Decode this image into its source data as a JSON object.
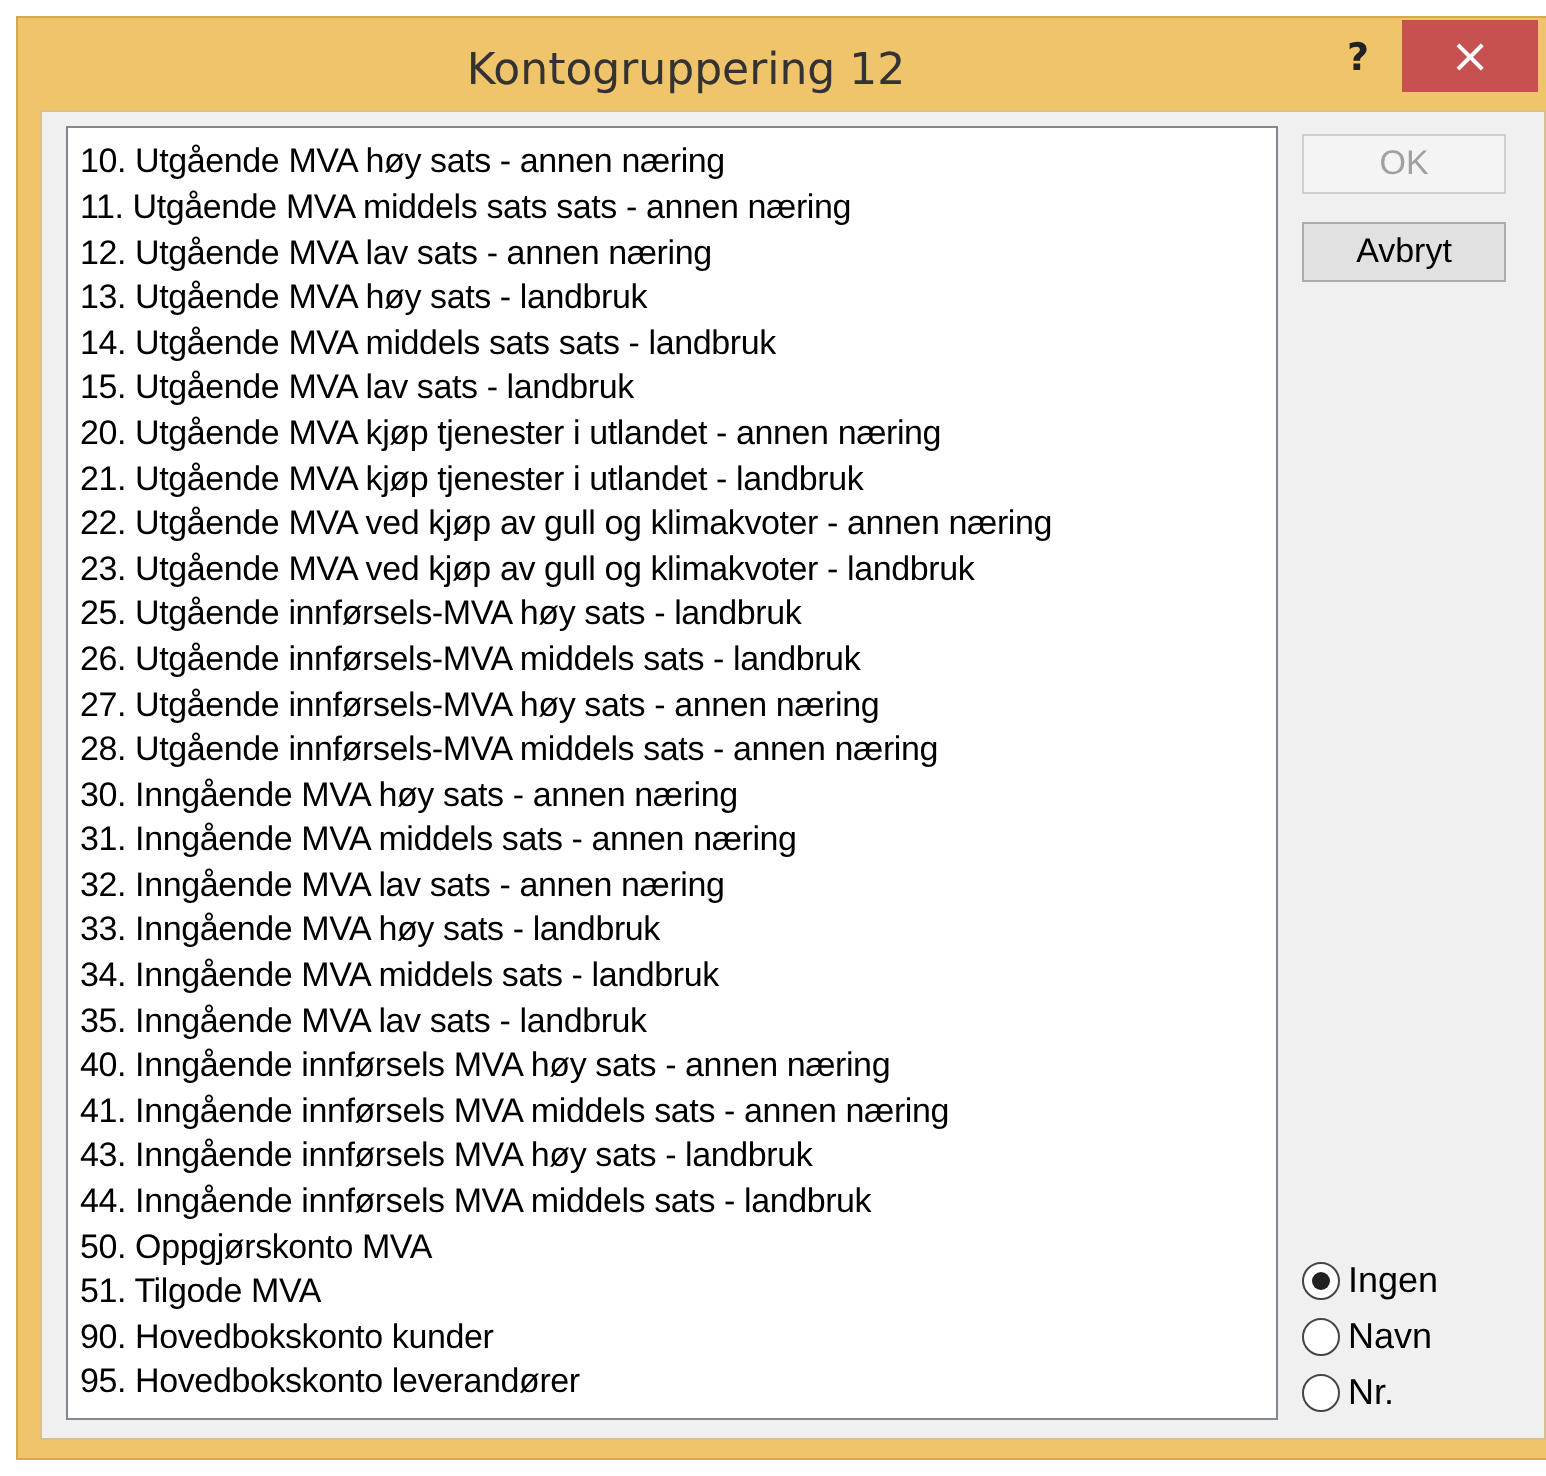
{
  "window": {
    "title": "Kontogruppering 12",
    "help": "?",
    "close": "×"
  },
  "accounts": [
    {
      "label": "10. Utgående MVA høy sats - annen næring",
      "selected": false
    },
    {
      "label": "11. Utgående MVA middels sats sats - annen næring",
      "selected": false
    },
    {
      "label": "12. Utgående MVA lav sats - annen næring",
      "selected": false
    },
    {
      "label": "13. Utgående MVA høy sats - landbruk",
      "selected": false
    },
    {
      "label": "14. Utgående MVA middels sats sats - landbruk",
      "selected": false
    },
    {
      "label": "15. Utgående MVA lav sats - landbruk",
      "selected": false
    },
    {
      "label": "20. Utgående MVA kjøp tjenester i utlandet - annen næring",
      "selected": false
    },
    {
      "label": "21. Utgående MVA kjøp tjenester i utlandet - landbruk",
      "selected": false
    },
    {
      "label": "22. Utgående MVA ved kjøp av gull og klimakvoter - annen næring",
      "selected": false
    },
    {
      "label": "23. Utgående MVA ved kjøp av gull og klimakvoter - landbruk",
      "selected": false
    },
    {
      "label": "25. Utgående innførsels-MVA høy sats - landbruk",
      "selected": false
    },
    {
      "label": "26. Utgående innførsels-MVA middels sats - landbruk",
      "selected": false
    },
    {
      "label": "27. Utgående innførsels-MVA høy sats - annen næring",
      "selected": false
    },
    {
      "label": "28. Utgående innførsels-MVA middels sats - annen næring",
      "selected": false
    },
    {
      "label": "30. Inngående MVA høy sats - annen næring",
      "selected": false
    },
    {
      "label": "31. Inngående MVA middels sats - annen næring",
      "selected": false
    },
    {
      "label": "32. Inngående MVA lav sats - annen næring",
      "selected": false
    },
    {
      "label": "33. Inngående MVA høy sats - landbruk",
      "selected": false
    },
    {
      "label": "34. Inngående MVA middels sats - landbruk",
      "selected": false
    },
    {
      "label": "35. Inngående MVA lav sats - landbruk",
      "selected": false
    },
    {
      "label": "40. Inngående innførsels MVA høy sats - annen næring",
      "selected": false
    },
    {
      "label": "41. Inngående innførsels MVA middels sats - annen næring",
      "selected": false
    },
    {
      "label": "43. Inngående innførsels MVA høy sats - landbruk",
      "selected": false
    },
    {
      "label": "44. Inngående innførsels MVA middels sats - landbruk",
      "selected": false
    },
    {
      "label": "50. Oppgjørskonto MVA",
      "selected": false
    },
    {
      "label": "51. Tilgode MVA",
      "selected": false
    },
    {
      "label": "90. Hovedbokskonto kunder",
      "selected": false
    },
    {
      "label": "95. Hovedbokskonto leverandører",
      "selected": false
    }
  ],
  "buttons": [
    {
      "label": "OK",
      "disabled": true
    },
    {
      "label": "Avbryt",
      "disabled": false
    }
  ],
  "sort": [
    {
      "label": "Ingen",
      "selected": true
    },
    {
      "label": "Navn",
      "selected": false
    },
    {
      "label": "Nr.",
      "selected": false
    }
  ]
}
